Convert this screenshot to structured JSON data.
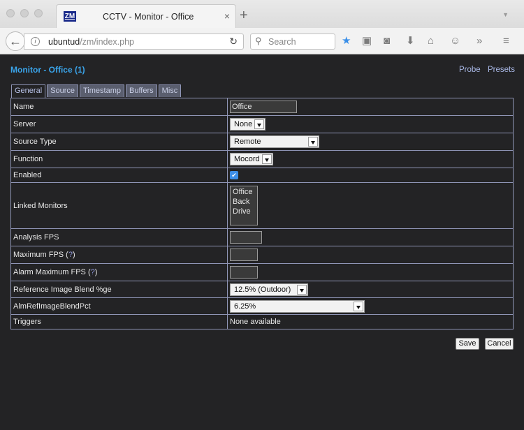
{
  "browser": {
    "tab_logo": "ZM",
    "tab_title": "CCTV - Monitor - Office",
    "url_host": "ubuntud",
    "url_path": "/zm/index.php",
    "search_placeholder": "Search",
    "new_tab_glyph": "+",
    "close_glyph": "×"
  },
  "header": {
    "title": "Monitor - Office (1)",
    "links": [
      "Probe",
      "Presets"
    ]
  },
  "tabs": [
    "General",
    "Source",
    "Timestamp",
    "Buffers",
    "Misc"
  ],
  "active_tab": "General",
  "form": {
    "name": {
      "label": "Name",
      "value": "Office"
    },
    "server": {
      "label": "Server",
      "value": "None"
    },
    "source_type": {
      "label": "Source Type",
      "value": "Remote"
    },
    "function": {
      "label": "Function",
      "value": "Mocord"
    },
    "enabled": {
      "label": "Enabled",
      "checked": true
    },
    "linked_monitors": {
      "label": "Linked Monitors",
      "options": [
        "Office",
        "Back",
        "Drive"
      ]
    },
    "analysis_fps": {
      "label": "Analysis FPS",
      "value": ""
    },
    "maximum_fps": {
      "label": "Maximum FPS (",
      "help": "?",
      "close": ")",
      "value": ""
    },
    "alarm_maximum_fps": {
      "label": "Alarm Maximum FPS (",
      "help": "?",
      "close": ")",
      "value": ""
    },
    "ref_blend": {
      "label": "Reference Image Blend %ge",
      "value": "12.5% (Outdoor)"
    },
    "alm_ref_blend": {
      "label": "AlmRefImageBlendPct",
      "value": "6.25%"
    },
    "triggers": {
      "label": "Triggers",
      "value": "None available"
    }
  },
  "buttons": {
    "save": "Save",
    "cancel": "Cancel"
  },
  "colors": {
    "title_accent": "#3aa4ea",
    "link": "#a9b8e6",
    "background": "#232325",
    "border": "#8f95b6",
    "checkbox": "#3d8ee8"
  },
  "icons": [
    "back-arrow-icon",
    "info-icon",
    "reload-icon",
    "search-icon",
    "bookmark-star-icon",
    "reading-list-icon",
    "pocket-icon",
    "download-icon",
    "home-icon",
    "emoji-icon",
    "overflow-icon",
    "menu-icon"
  ]
}
